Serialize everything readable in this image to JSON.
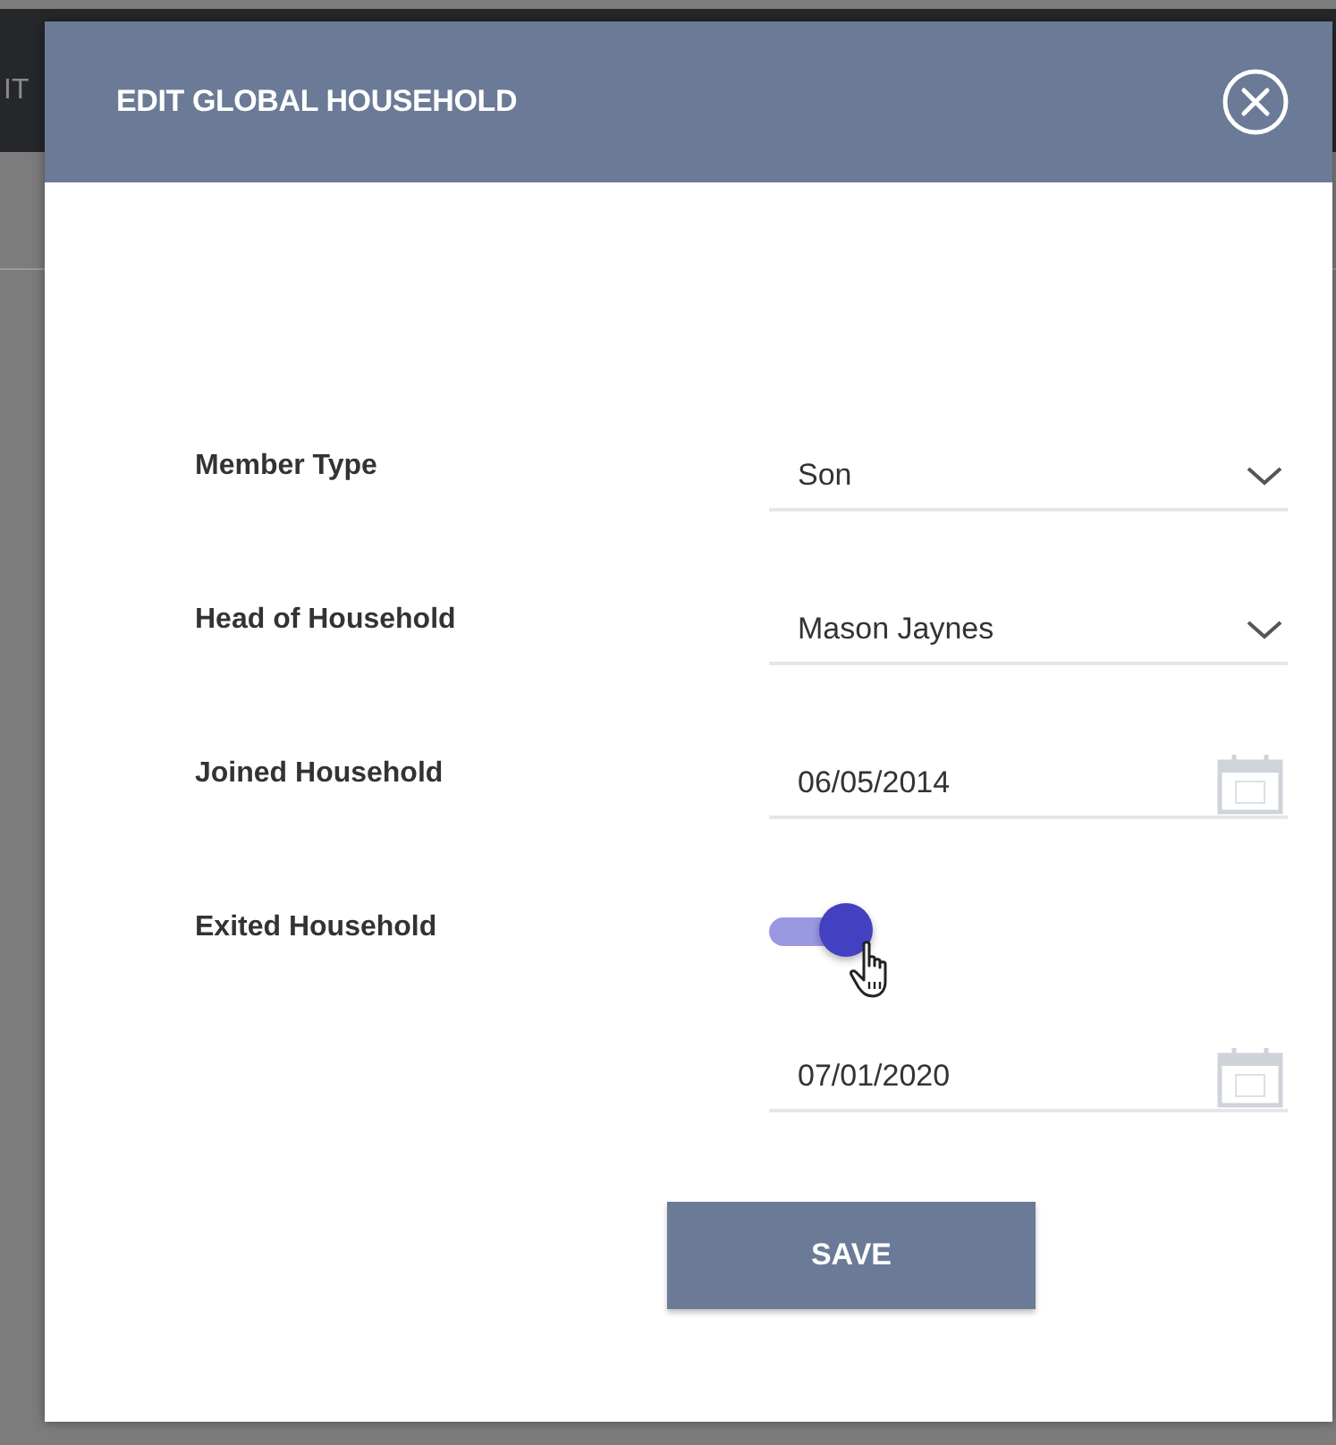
{
  "background": {
    "nav_text": "IT"
  },
  "dialog": {
    "title": "EDIT GLOBAL HOUSEHOLD",
    "fields": [
      {
        "kind": "select",
        "label": "Member Type",
        "value": "Son"
      },
      {
        "kind": "select",
        "label": "Head of Household",
        "value": "Mason Jaynes"
      },
      {
        "kind": "date",
        "label": "Joined Household",
        "value": "06/05/2014"
      },
      {
        "kind": "toggle-date",
        "label": "Exited Household",
        "on": true,
        "value": "07/01/2020"
      }
    ],
    "save_button": "SAVE"
  }
}
